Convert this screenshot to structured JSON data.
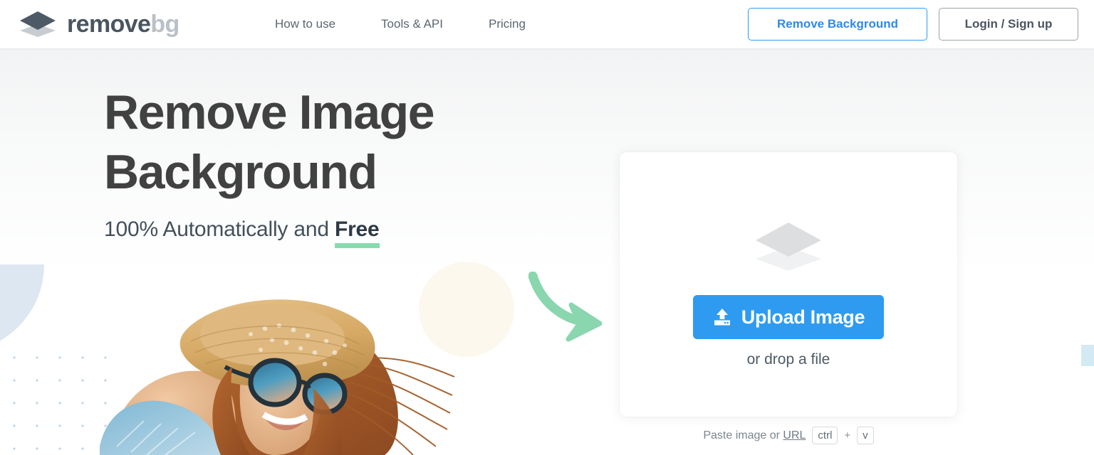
{
  "brand": {
    "logo_icon": "stacked-layers-icon",
    "name_primary": "remove",
    "name_secondary": "bg"
  },
  "header": {
    "nav": [
      {
        "label": "How to use"
      },
      {
        "label": "Tools & API"
      },
      {
        "label": "Pricing"
      }
    ],
    "remove_background_label": "Remove Background",
    "login_label": "Login / Sign up"
  },
  "hero": {
    "title": "Remove Image\nBackground",
    "subtitle_prefix": "100% Automatically and ",
    "subtitle_highlight": "Free",
    "photo_alt": "smiling-woman-straw-hat-sunglasses"
  },
  "upload": {
    "layers_icon": "stacked-layers-icon",
    "upload_icon": "upload-tray-icon",
    "button_label": "Upload Image",
    "drop_hint": "or drop a file",
    "paste_prefix": "Paste image or ",
    "paste_url_label": "URL",
    "shortcut_key": "ctrl",
    "shortcut_plus": "+",
    "shortcut_key2": "v"
  },
  "colors": {
    "accent_blue": "#2e9bf0",
    "logo_dark": "#4a5560",
    "logo_light": "#b9c1c8",
    "highlight_green": "#86dcae",
    "arrow_green": "#8ad6ae",
    "cream_circle": "#fcf8ee",
    "dots_blue": "#bed4ea",
    "quarter_circle_blue": "#dde7f2",
    "edge_tab_blue": "#d3eaf4",
    "heading_gray": "#414141"
  }
}
